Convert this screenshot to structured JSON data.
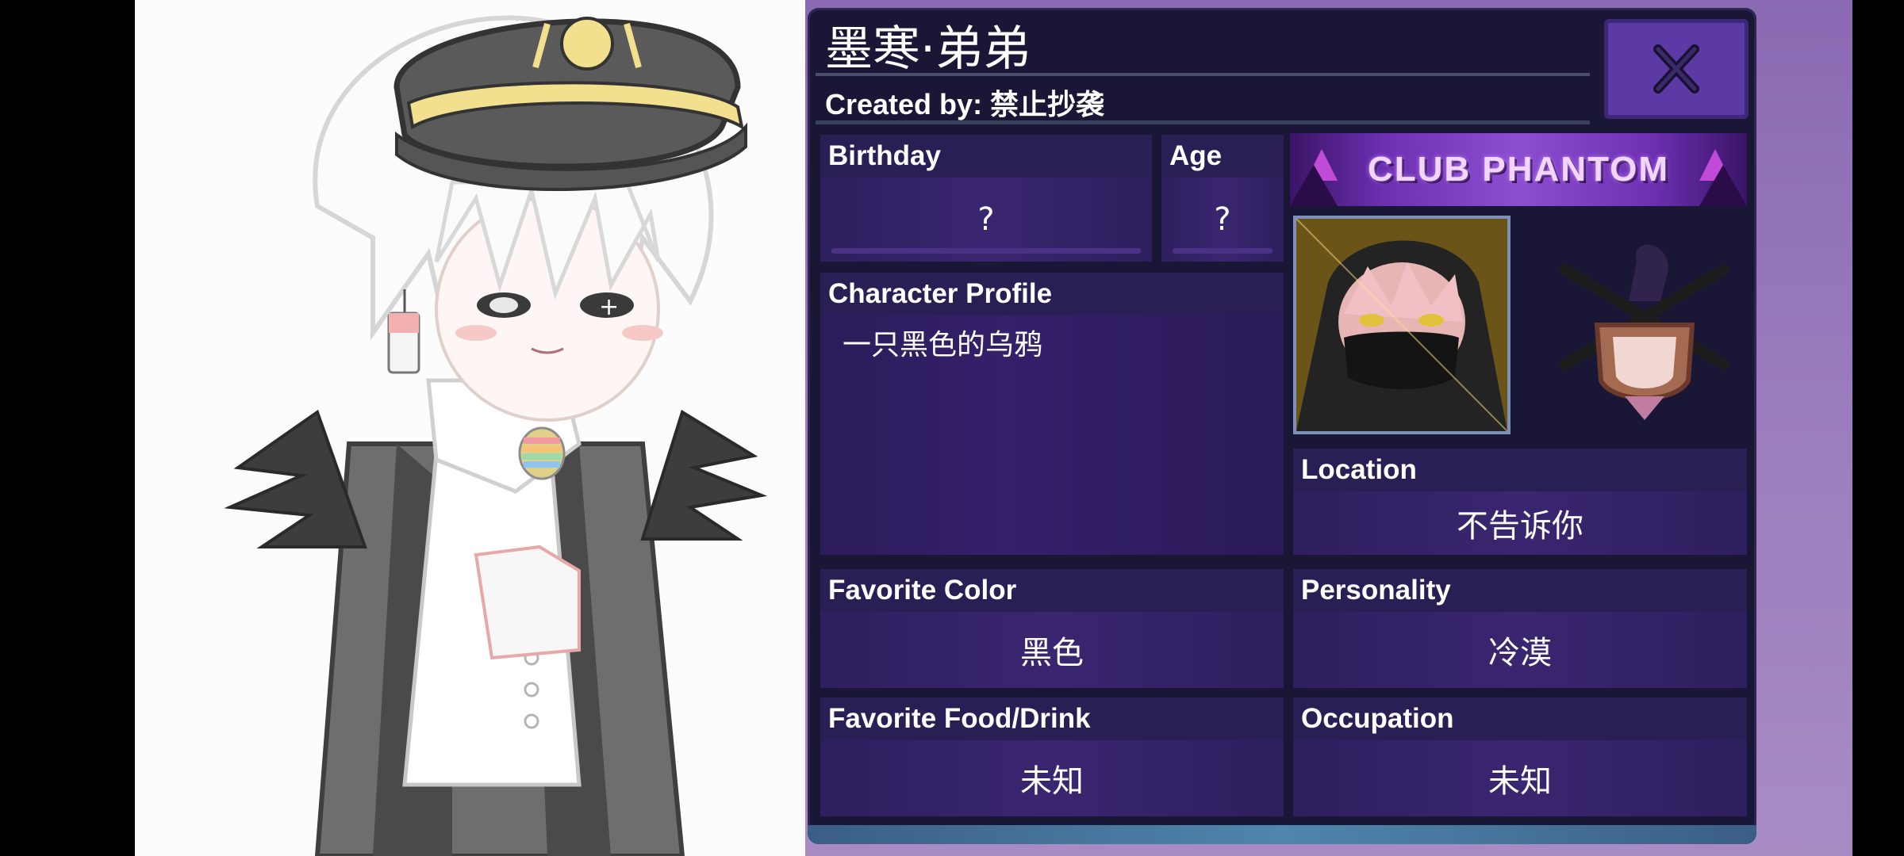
{
  "profile": {
    "name": "墨寒·弟弟",
    "created_by": "Created by: 禁止抄袭",
    "close_label": "X",
    "birthday": {
      "label": "Birthday",
      "value": "?"
    },
    "age": {
      "label": "Age",
      "value": "?"
    },
    "character_profile": {
      "label": "Character Profile",
      "value": "一只黑色的乌鸦"
    },
    "location": {
      "label": "Location",
      "value": "不告诉你"
    },
    "favorite_color": {
      "label": "Favorite Color",
      "value": "黑色"
    },
    "personality": {
      "label": "Personality",
      "value": "冷漠"
    },
    "favorite_food": {
      "label": "Favorite Food/Drink",
      "value": "未知"
    },
    "occupation": {
      "label": "Occupation",
      "value": "未知"
    },
    "banner_text": "CLUB PHANTOM"
  },
  "colors": {
    "panel_bg": "#1a1636",
    "value_bg": "#3a2670",
    "close_button": "#5c3aa6",
    "purple_background": "#9a7bbd"
  },
  "icons": {
    "close": "close-icon",
    "badge": "club-crest-icon",
    "avatar": "character-avatar"
  }
}
